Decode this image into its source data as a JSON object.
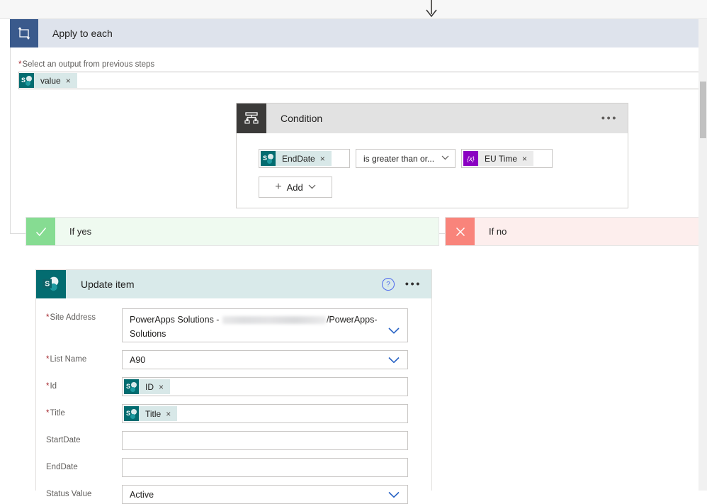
{
  "canvas": {
    "connector": {
      "icon": "down-arrow-icon"
    }
  },
  "apply_to_each": {
    "icon": "loop-icon",
    "title": "Apply to each",
    "field": {
      "required": true,
      "required_marker": "*",
      "label": "Select an output from previous steps",
      "token": {
        "icon": "sharepoint-icon",
        "text": "value",
        "remove": "×"
      }
    }
  },
  "condition": {
    "icon": "condition-icon",
    "title": "Condition",
    "overflow_menu": "•••",
    "row": {
      "left_token": {
        "icon": "sharepoint-icon",
        "text": "EndDate",
        "remove": "×"
      },
      "operator": {
        "value": "is greater than or...",
        "chevron": "chevron-down-icon"
      },
      "right_token": {
        "icon": "expression-icon",
        "icon_glyph": "{x}",
        "text": "EU Time",
        "remove": "×"
      }
    },
    "add_button": {
      "plus": "+",
      "label": "Add",
      "chevron": "chevron-down-icon"
    }
  },
  "branches": {
    "yes": {
      "icon": "checkmark-icon",
      "label": "If yes",
      "color": "#86dc92"
    },
    "no": {
      "icon": "cross-icon",
      "label": "If no",
      "color": "#f9847b"
    }
  },
  "update_item": {
    "icon": "sharepoint-icon",
    "title": "Update item",
    "help": "?",
    "overflow_menu": "•••",
    "fields": [
      {
        "label": "Site Address",
        "required": true,
        "type": "dropdown-redacted",
        "value_prefix": "PowerApps Solutions - ",
        "value_suffix": "/PowerApps-Solutions",
        "redacted": true,
        "chevron": "chevron-down-icon"
      },
      {
        "label": "List Name",
        "required": true,
        "type": "dropdown",
        "value": "A90",
        "chevron": "chevron-down-icon"
      },
      {
        "label": "Id",
        "required": true,
        "type": "token",
        "token": {
          "icon": "sharepoint-icon",
          "text": "ID",
          "remove": "×"
        }
      },
      {
        "label": "Title",
        "required": true,
        "type": "token",
        "token": {
          "icon": "sharepoint-icon",
          "text": "Title",
          "remove": "×"
        }
      },
      {
        "label": "StartDate",
        "required": false,
        "type": "text",
        "value": ""
      },
      {
        "label": "EndDate",
        "required": false,
        "type": "text",
        "value": ""
      },
      {
        "label": "Status Value",
        "required": false,
        "type": "dropdown",
        "value": "Active",
        "chevron": "chevron-down-icon"
      }
    ]
  },
  "scrollbar": {
    "name": "vertical-scrollbar"
  },
  "colors": {
    "scope_header": "#dee3ec",
    "scope_icon": "#3a5a8c",
    "condition_header": "#e2e2e2",
    "sharepoint_teal": "#036c70",
    "expression_purple": "#8a00c2",
    "yes_green": "#86dc92",
    "no_red": "#f9847b",
    "link_blue": "#2661c4"
  }
}
